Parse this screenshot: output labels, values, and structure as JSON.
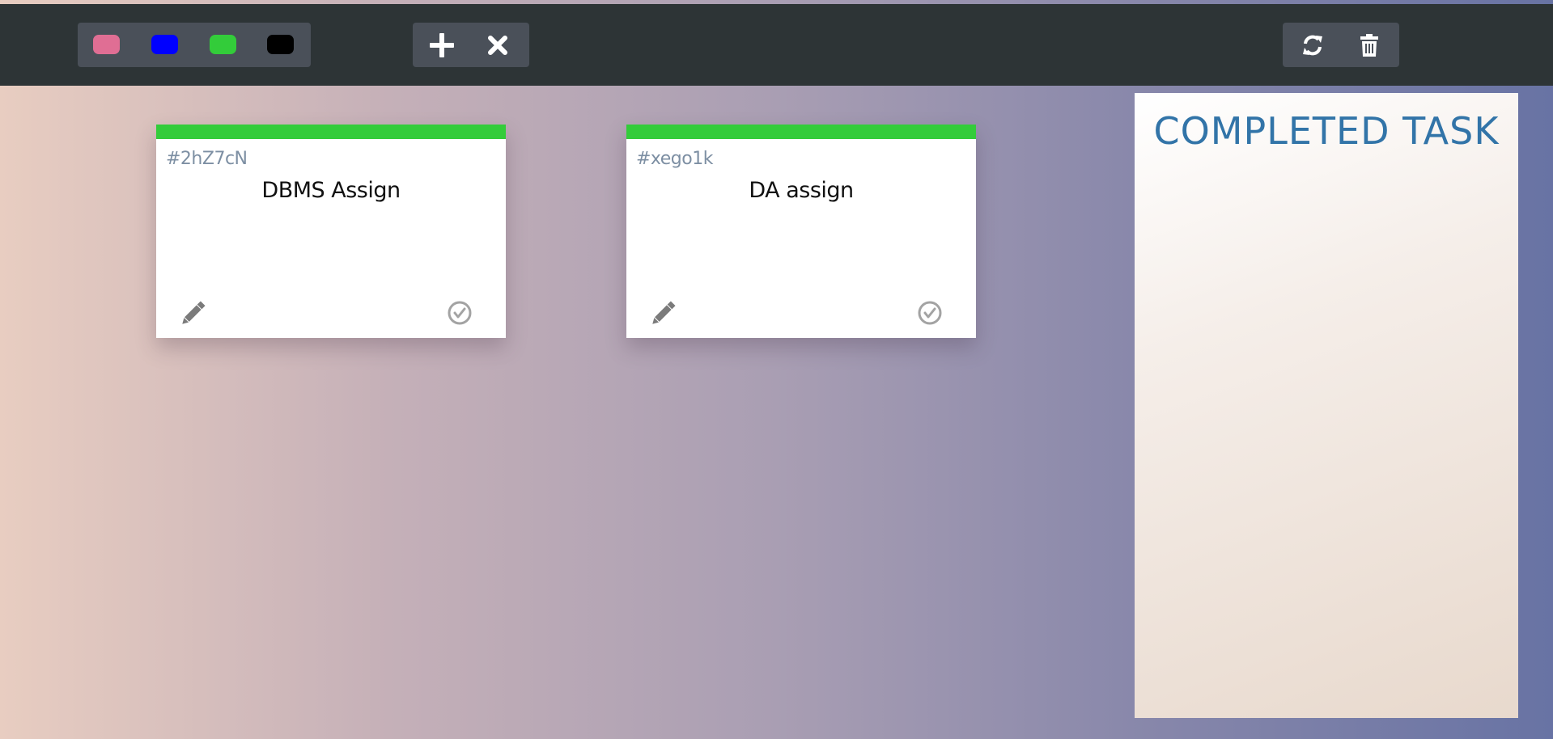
{
  "toolbar": {
    "color_swatches": [
      {
        "name": "pink",
        "color": "#e06e94"
      },
      {
        "name": "blue",
        "color": "#0000ff"
      },
      {
        "name": "green",
        "color": "#33cc3a"
      },
      {
        "name": "black",
        "color": "#000000"
      }
    ],
    "actions": {
      "add_icon": "plus-icon",
      "remove_icon": "close-icon",
      "refresh_icon": "refresh-icon",
      "delete_icon": "trash-icon"
    }
  },
  "tasks": [
    {
      "id": "#2hZ7cN",
      "title": "DBMS Assign",
      "color": "#33cc3a"
    },
    {
      "id": "#xego1k",
      "title": "DA assign",
      "color": "#33cc3a"
    }
  ],
  "completed_panel": {
    "title": "COMPLETED TASK"
  },
  "colors": {
    "topbar": "#2d3436",
    "toolgroup": "#4a5059",
    "id_text": "#7d8fa3",
    "completed_title": "#3274a8"
  }
}
